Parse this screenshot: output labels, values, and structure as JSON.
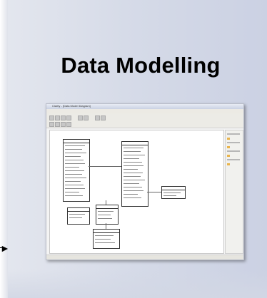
{
  "slide": {
    "title": "Data Modelling"
  },
  "screenshot": {
    "window_title": "Clarity - [Data Model Diagram]",
    "menu": [
      "File",
      "Edit",
      "View",
      "Insert",
      "Format",
      "Tools",
      "Window",
      "Help"
    ]
  },
  "colors": {
    "card_background": "#d6dbe8",
    "accent_swatch": "#e9b44c"
  }
}
